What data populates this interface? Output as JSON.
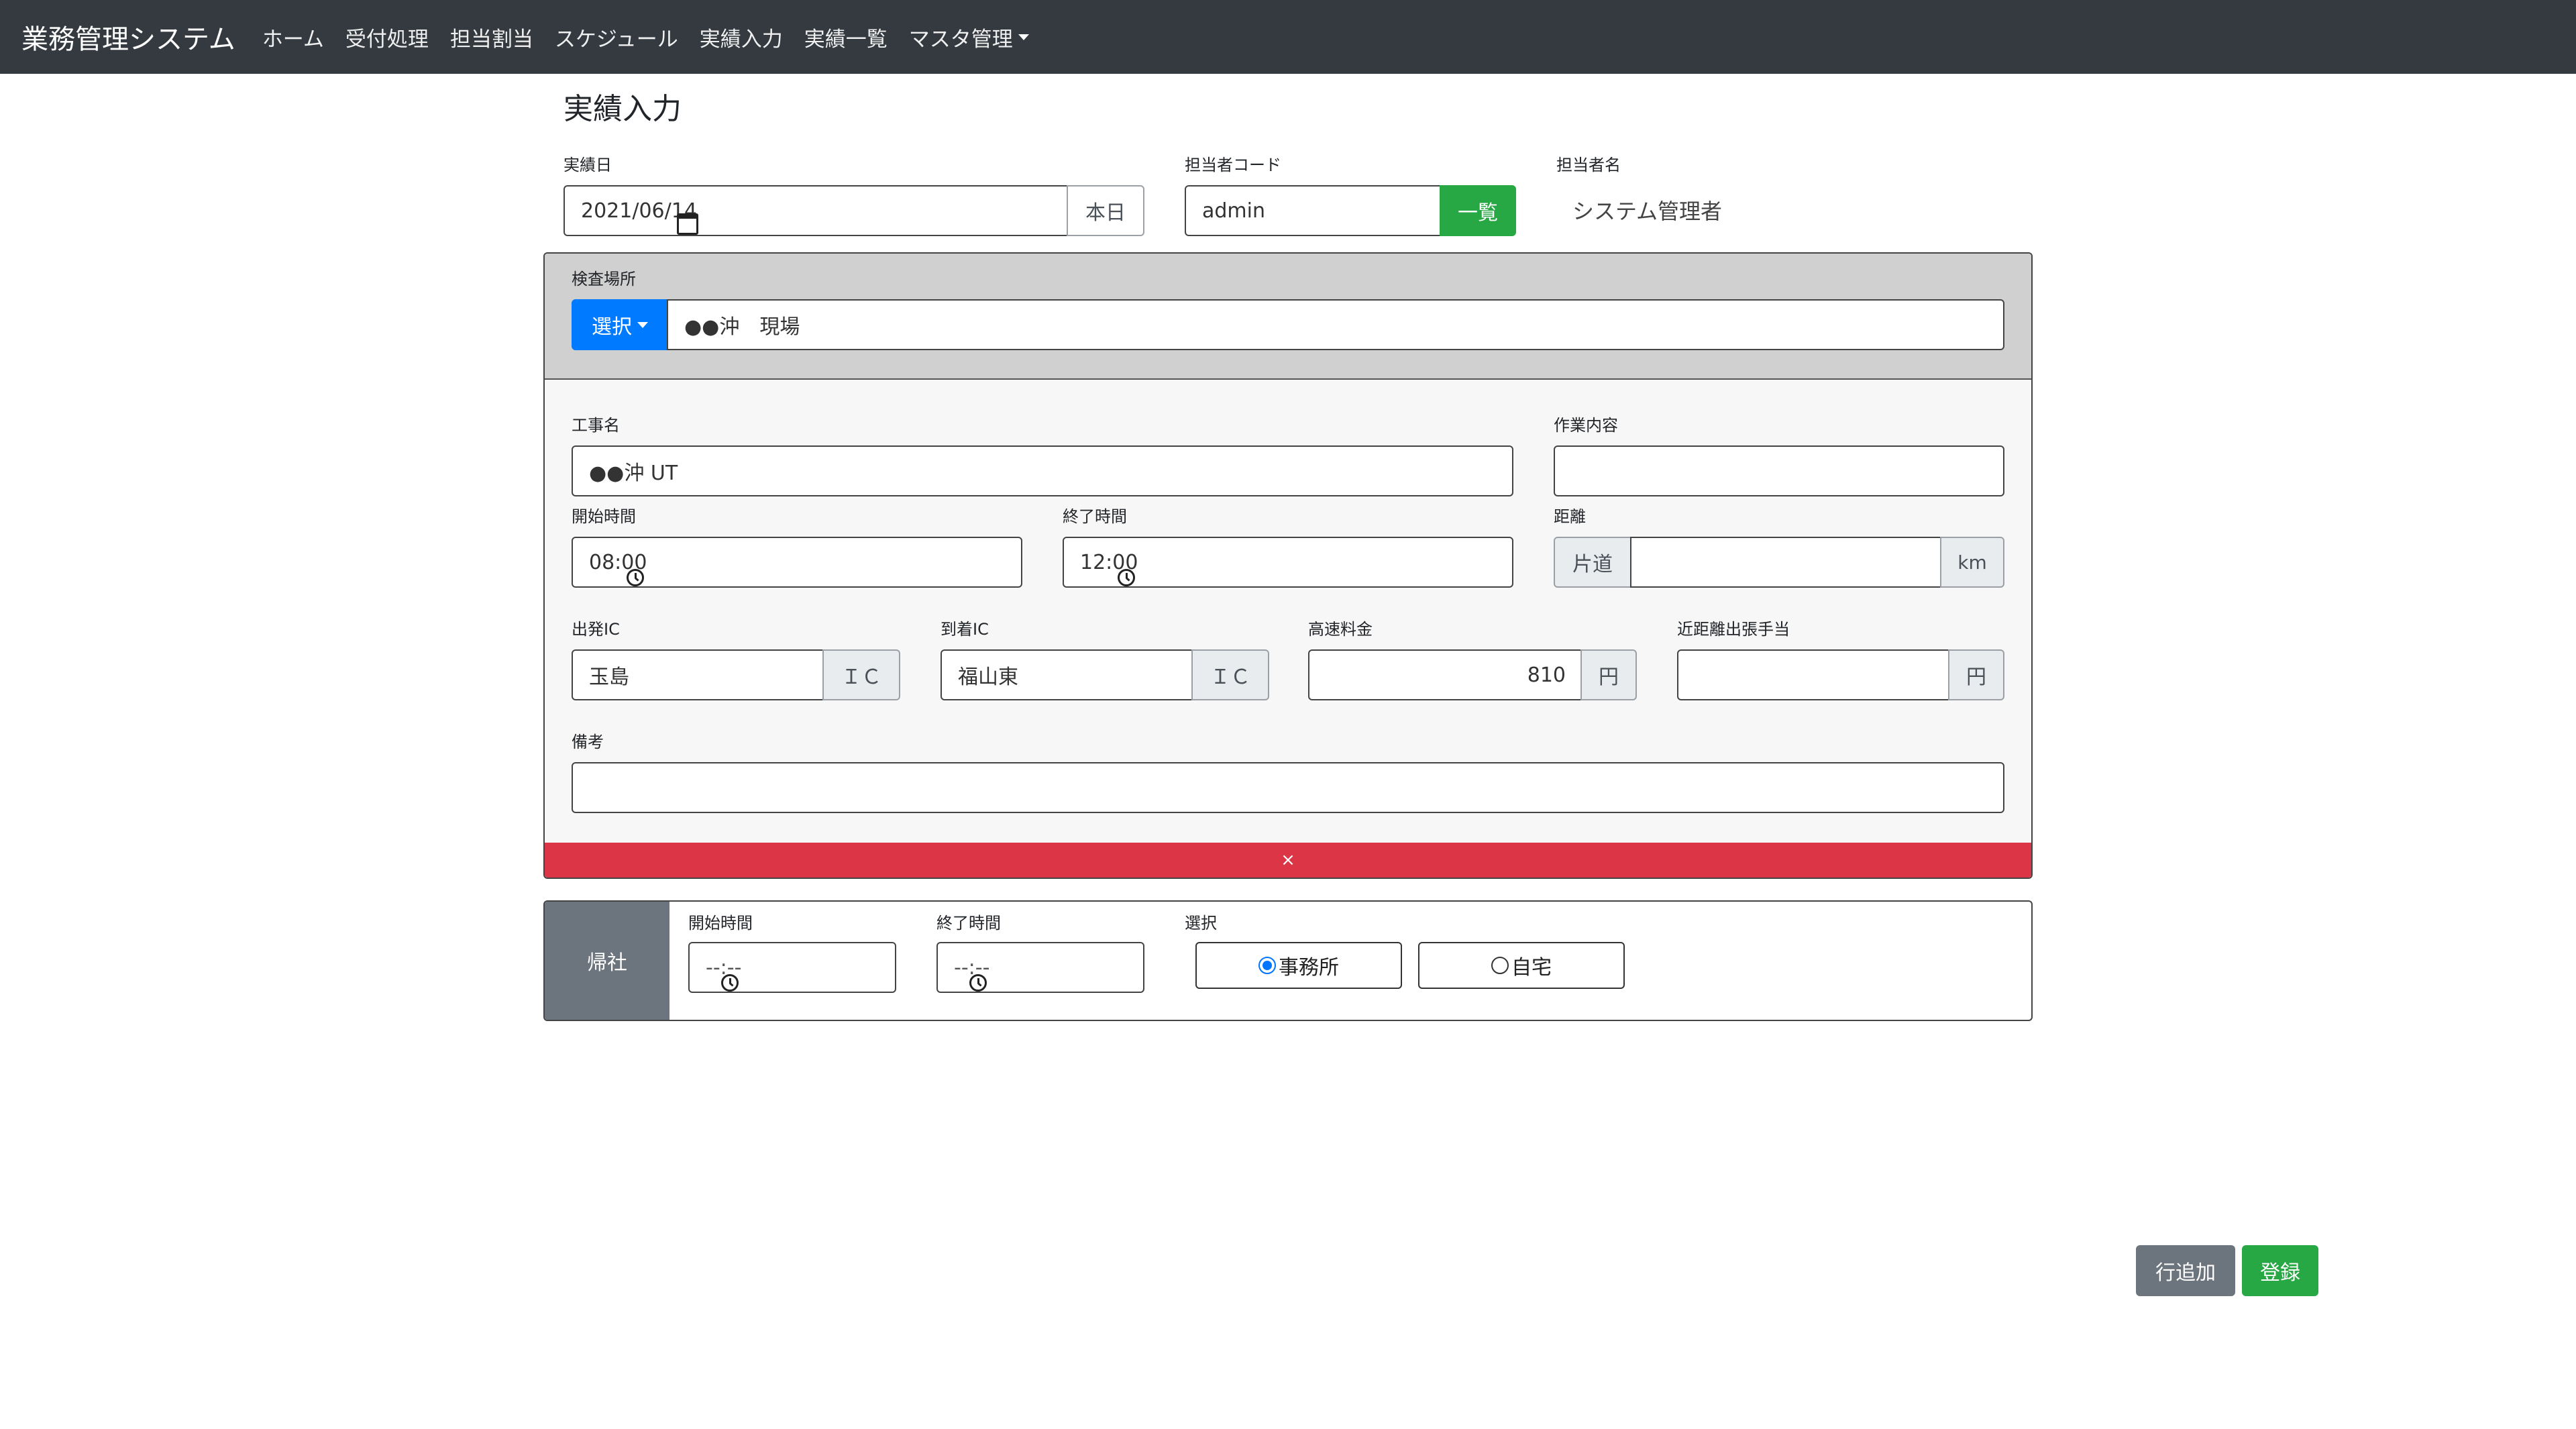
{
  "navbar": {
    "brand": "業務管理システム",
    "items": [
      "ホーム",
      "受付処理",
      "担当割当",
      "スケジュール",
      "実績入力",
      "実績一覧",
      "マスタ管理"
    ]
  },
  "page": {
    "title": "実績入力"
  },
  "header": {
    "date_label": "実績日",
    "date_value": "2021/06/14",
    "today_button": "本日",
    "staff_code_label": "担当者コード",
    "staff_code_value": "admin",
    "list_button": "一覧",
    "staff_name_label": "担当者名",
    "staff_name_value": "システム管理者"
  },
  "site": {
    "label": "検査場所",
    "select_button": "選択",
    "value": "●●沖　現場"
  },
  "work": {
    "project_label": "工事名",
    "project_value": "●●沖 UT",
    "content_label": "作業内容",
    "content_value": "",
    "start_label": "開始時間",
    "start_value": "08:00",
    "end_label": "終了時間",
    "end_value": "12:00",
    "distance_label": "距離",
    "distance_prefix": "片道",
    "distance_value": "",
    "distance_unit": "km",
    "dep_ic_label": "出発IC",
    "dep_ic_value": "玉島",
    "ic_suffix": "ＩＣ",
    "arr_ic_label": "到着IC",
    "arr_ic_value": "福山東",
    "toll_label": "高速料金",
    "toll_value": "810",
    "yen": "円",
    "allowance_label": "近距離出張手当",
    "allowance_value": "",
    "note_label": "備考",
    "note_value": "",
    "remove_symbol": "×"
  },
  "return": {
    "title": "帰社",
    "start_label": "開始時間",
    "start_placeholder": "--:--",
    "end_label": "終了時間",
    "end_placeholder": "--:--",
    "select_label": "選択",
    "option_office": "事務所",
    "option_home": "自宅"
  },
  "actions": {
    "add_row": "行追加",
    "register": "登録"
  },
  "colors": {
    "navbar": "#343a40",
    "green": "#28a745",
    "blue": "#007bff",
    "gray": "#6c757d",
    "red": "#dc3545"
  }
}
